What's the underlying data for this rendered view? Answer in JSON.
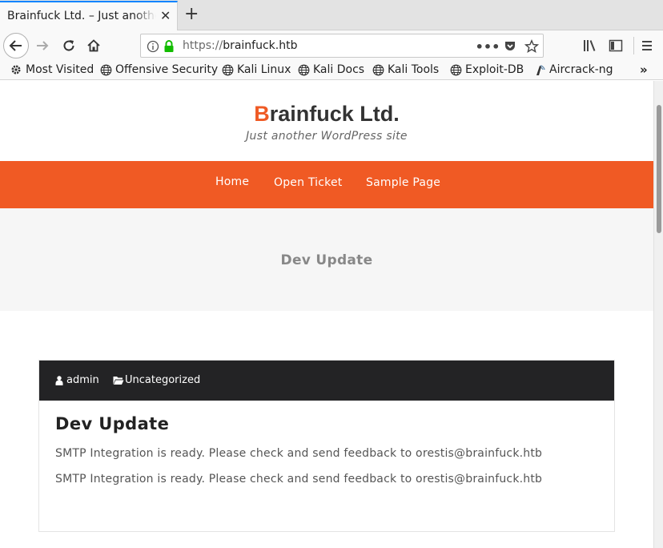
{
  "browser": {
    "tab_title": "Brainfuck Ltd. – Just another WordPress site",
    "url_protocol": "https://",
    "url_host": "brainfuck.htb",
    "bookmarks": [
      {
        "label": "Most Visited",
        "icon": "gear-icon"
      },
      {
        "label": "Offensive Security",
        "icon": "globe-icon"
      },
      {
        "label": "Kali Linux",
        "icon": "globe-icon"
      },
      {
        "label": "Kali Docs",
        "icon": "globe-icon"
      },
      {
        "label": "Kali Tools",
        "icon": "globe-icon"
      },
      {
        "label": "Exploit-DB",
        "icon": "globe-icon"
      },
      {
        "label": "Aircrack-ng",
        "icon": "aircrack-icon"
      }
    ]
  },
  "site": {
    "title_first": "B",
    "title_rest": "rainfuck Ltd.",
    "tagline": "Just another WordPress site",
    "menu": [
      "Home",
      "Open Ticket",
      "Sample Page"
    ],
    "hero_title": "Dev Update"
  },
  "post": {
    "author": "admin",
    "category": "Uncategorized",
    "title": "Dev Update",
    "lines": [
      "SMTP Integration is ready. Please check and send feedback to orestis@brainfuck.htb",
      "SMTP Integration is ready. Please check and send feedback to orestis@brainfuck.htb"
    ]
  },
  "colors": {
    "accent": "#f05a24",
    "meta_bar": "#232325",
    "tab_highlight": "#0a84ff"
  }
}
